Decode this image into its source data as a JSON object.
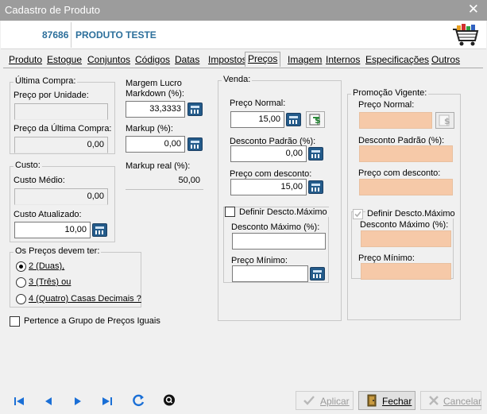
{
  "window": {
    "title": "Cadastro de Produto",
    "close_glyph": "✕"
  },
  "header": {
    "code": "87686",
    "name": "PRODUTO TESTE",
    "icon": "shopping-cart-icon"
  },
  "tabs": [
    {
      "label": "Produto"
    },
    {
      "label": "Estogue"
    },
    {
      "label": "Conjuntos"
    },
    {
      "label": "Códigos"
    },
    {
      "label": "Datas"
    },
    {
      "label": "Impostos"
    },
    {
      "label": "Preços",
      "active": true
    },
    {
      "label": "Imagem"
    },
    {
      "label": "Internos"
    },
    {
      "label": "Especificações"
    },
    {
      "label": "Outros"
    }
  ],
  "ultima_compra": {
    "legend": "Última Compra:",
    "preco_unidade_label": "Preço por Unidade:",
    "preco_unidade_value": "",
    "preco_ultima_label": "Preço da Última Compra:",
    "preco_ultima_value": "0,00"
  },
  "custo": {
    "legend": "Custo:",
    "medio_label": "Custo Médio:",
    "medio_value": "0,00",
    "atualizado_label": "Custo Atualizado:",
    "atualizado_value": "10,00"
  },
  "precos_devem": {
    "legend": "Os Preços devem ter:",
    "options": [
      "2 (Duas),",
      "3 (Três) ou",
      "4 (Quatro) Casas Decimais ?"
    ],
    "selected_index": 0
  },
  "pertence_label": "Pertence a Grupo de Preços Iguais",
  "margem": {
    "label": "Margem Lucro Markdown (%):",
    "value": "33,3333",
    "markup_label": "Markup (%):",
    "markup_value": "0,00",
    "markup_real_label": "Markup real (%):",
    "markup_real_value": "50,00"
  },
  "venda": {
    "legend": "Venda:",
    "preco_normal_label": "Preço Normal:",
    "preco_normal_value": "15,00",
    "desconto_padrao_label": "Desconto Padrão (%):",
    "desconto_padrao_value": "0,00",
    "preco_desconto_label": "Preço com desconto:",
    "preco_desconto_value": "15,00",
    "definir_label": "Definir Descto.Máximo",
    "desconto_maximo_label": "Desconto Máximo (%):",
    "desconto_maximo_value": "",
    "preco_minimo_label": "Preço Mínimo:",
    "preco_minimo_value": ""
  },
  "promocao": {
    "legend": "Promoção Vigente:",
    "preco_normal_label": "Preço Normal:",
    "desconto_padrao_label": "Desconto Padrão (%):",
    "preco_desconto_label": "Preço com desconto:",
    "definir_label": "Definir Descto.Máximo",
    "desconto_maximo_label": "Desconto Máximo (%):",
    "preco_minimo_label": "Preço Mínimo:"
  },
  "buttons": {
    "aplicar": "Aplicar",
    "fechar": "Fechar",
    "cancelar": "Cancelar"
  },
  "colors": {
    "accent": "#2c6f9b",
    "nav_blue": "#1a6fd6",
    "peach": "#f6c9a8",
    "calc_blue": "#245b8a"
  }
}
